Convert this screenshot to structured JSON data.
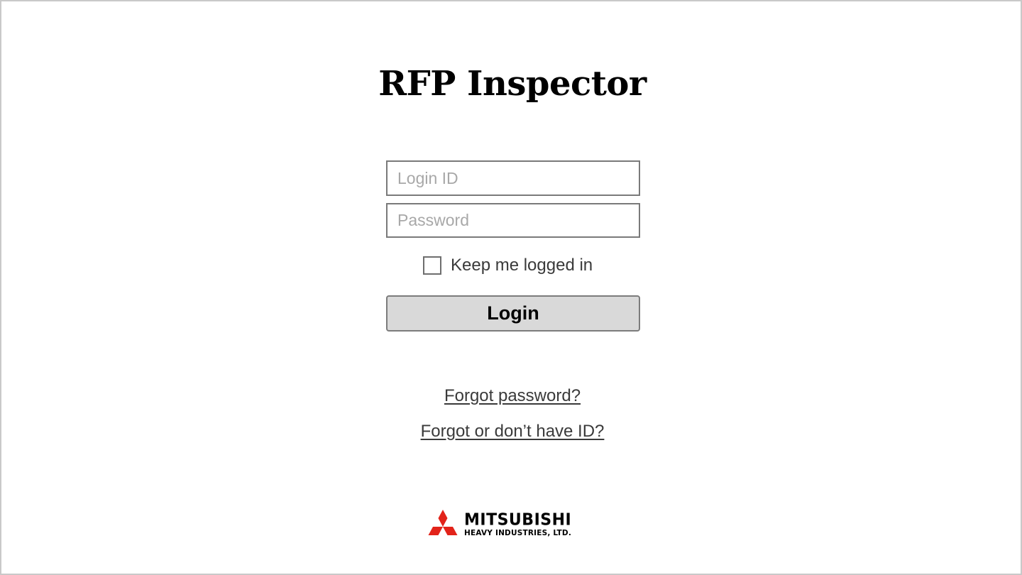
{
  "app": {
    "title": "RFP Inspector"
  },
  "form": {
    "login_id": {
      "value": "",
      "placeholder": "Login ID"
    },
    "password": {
      "value": "",
      "placeholder": "Password"
    },
    "keep_logged_in": {
      "label": "Keep me logged in",
      "checked": false
    },
    "login_button": "Login"
  },
  "links": {
    "forgot_password": "Forgot password?",
    "forgot_id": "Forgot or don’t have ID?"
  },
  "footer": {
    "logo": {
      "name": "MITSUBISHI",
      "subtitle": "HEAVY INDUSTRIES, LTD.",
      "icon": "three-diamonds-logo-icon",
      "color": "#e2231a"
    }
  }
}
